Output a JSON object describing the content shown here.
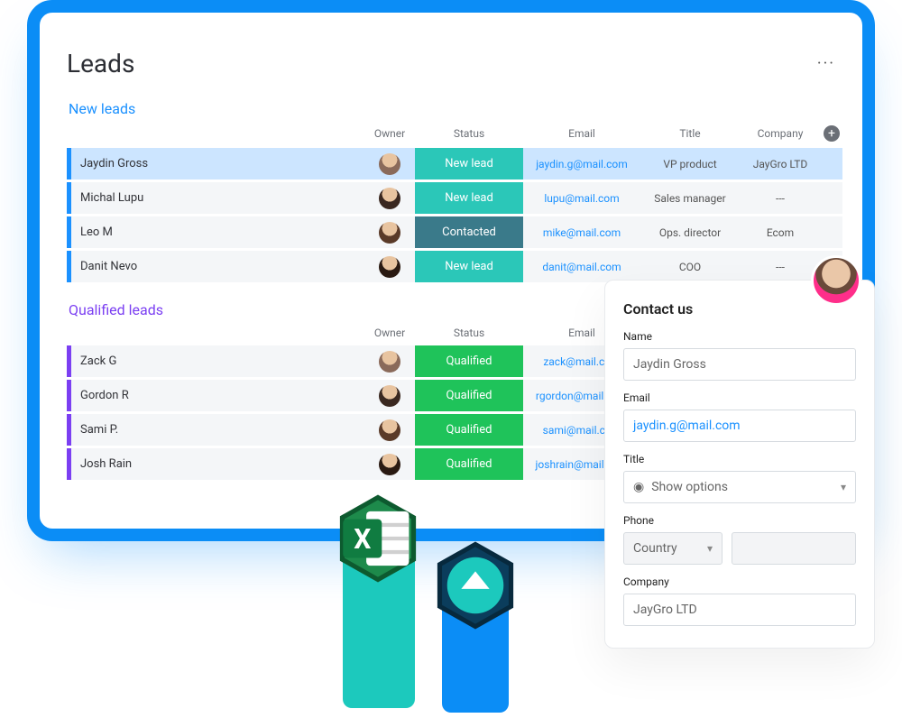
{
  "page": {
    "title": "Leads"
  },
  "columns": {
    "owner": "Owner",
    "status": "Status",
    "email": "Email",
    "title": "Title",
    "company": "Company"
  },
  "status_labels": {
    "new_lead": "New lead",
    "contacted": "Contacted",
    "qualified": "Qualified"
  },
  "groups": {
    "new": {
      "title": "New leads",
      "rows": [
        {
          "name": "Jaydin Gross",
          "status": "new_lead",
          "email": "jaydin.g@mail.com",
          "title": "VP product",
          "company": "JayGro LTD",
          "selected": true
        },
        {
          "name": "Michal Lupu",
          "status": "new_lead",
          "email": "lupu@mail.com",
          "title": "Sales manager",
          "company": "---"
        },
        {
          "name": "Leo M",
          "status": "contacted",
          "email": "mike@mail.com",
          "title": "Ops. director",
          "company": "Ecom"
        },
        {
          "name": "Danit Nevo",
          "status": "new_lead",
          "email": "danit@mail.com",
          "title": "COO",
          "company": "---"
        }
      ]
    },
    "qualified": {
      "title": "Qualified leads",
      "rows": [
        {
          "name": "Zack G",
          "status": "qualified",
          "email": "zack@mail.com"
        },
        {
          "name": "Gordon R",
          "status": "qualified",
          "email": "rgordon@mail.com"
        },
        {
          "name": "Sami P.",
          "status": "qualified",
          "email": "sami@mail.com"
        },
        {
          "name": "Josh Rain",
          "status": "qualified",
          "email": "joshrain@mail.com"
        }
      ]
    }
  },
  "contact_card": {
    "heading": "Contact us",
    "labels": {
      "name": "Name",
      "email": "Email",
      "title": "Title",
      "phone": "Phone",
      "company": "Company"
    },
    "values": {
      "name": "Jaydin Gross",
      "email": "jaydin.g@mail.com",
      "title_select": "Show options",
      "phone_country": "Country",
      "company": "JayGro LTD"
    }
  },
  "icons": {
    "excel_letter": "X",
    "plus": "+"
  }
}
